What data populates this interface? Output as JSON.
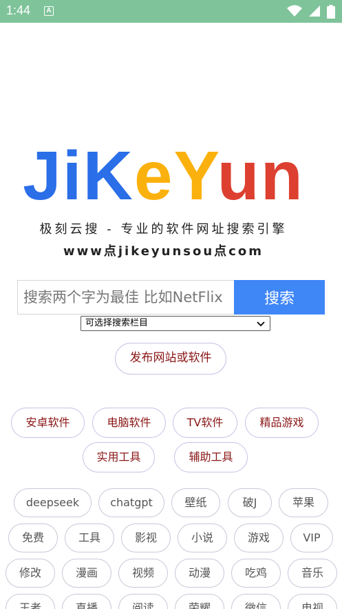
{
  "status_bar": {
    "time": "1:44",
    "notification_letter": "A"
  },
  "logo": {
    "letters": [
      {
        "char": "J",
        "color": "#2a6ee8"
      },
      {
        "char": "i",
        "color": "#2a6ee8"
      },
      {
        "char": "K",
        "color": "#2a6ee8"
      },
      {
        "char": "e",
        "color": "#fbb10d"
      },
      {
        "char": "Y",
        "color": "#fbb10d"
      },
      {
        "char": "u",
        "color": "#dd4030"
      },
      {
        "char": "n",
        "color": "#dd4030"
      }
    ]
  },
  "tagline": "极刻云搜 - 专业的软件网址搜索引擎",
  "site_url": "www点jikeyunsou点com",
  "search": {
    "placeholder": "搜索两个字为最佳 比如NetFlix",
    "button_label": "搜索"
  },
  "category_select": {
    "selected": "可选择搜索栏目"
  },
  "publish_button": "发布网站或软件",
  "categories": [
    "安卓软件",
    "电脑软件",
    "TV软件",
    "精品游戏",
    "实用工具",
    "辅助工具"
  ],
  "tags": [
    "deepseek",
    "chatgpt",
    "壁纸",
    "破J",
    "苹果",
    "免费",
    "工具",
    "影视",
    "小说",
    "游戏",
    "VIP",
    "修改",
    "漫画",
    "视频",
    "动漫",
    "吃鸡",
    "音乐",
    "王者",
    "直播",
    "阅读",
    "荣耀",
    "微信",
    "电视"
  ],
  "colors": {
    "status_bar": "#7fc39a",
    "search_button": "#3f86f7",
    "pill_text": "#8a1515"
  }
}
